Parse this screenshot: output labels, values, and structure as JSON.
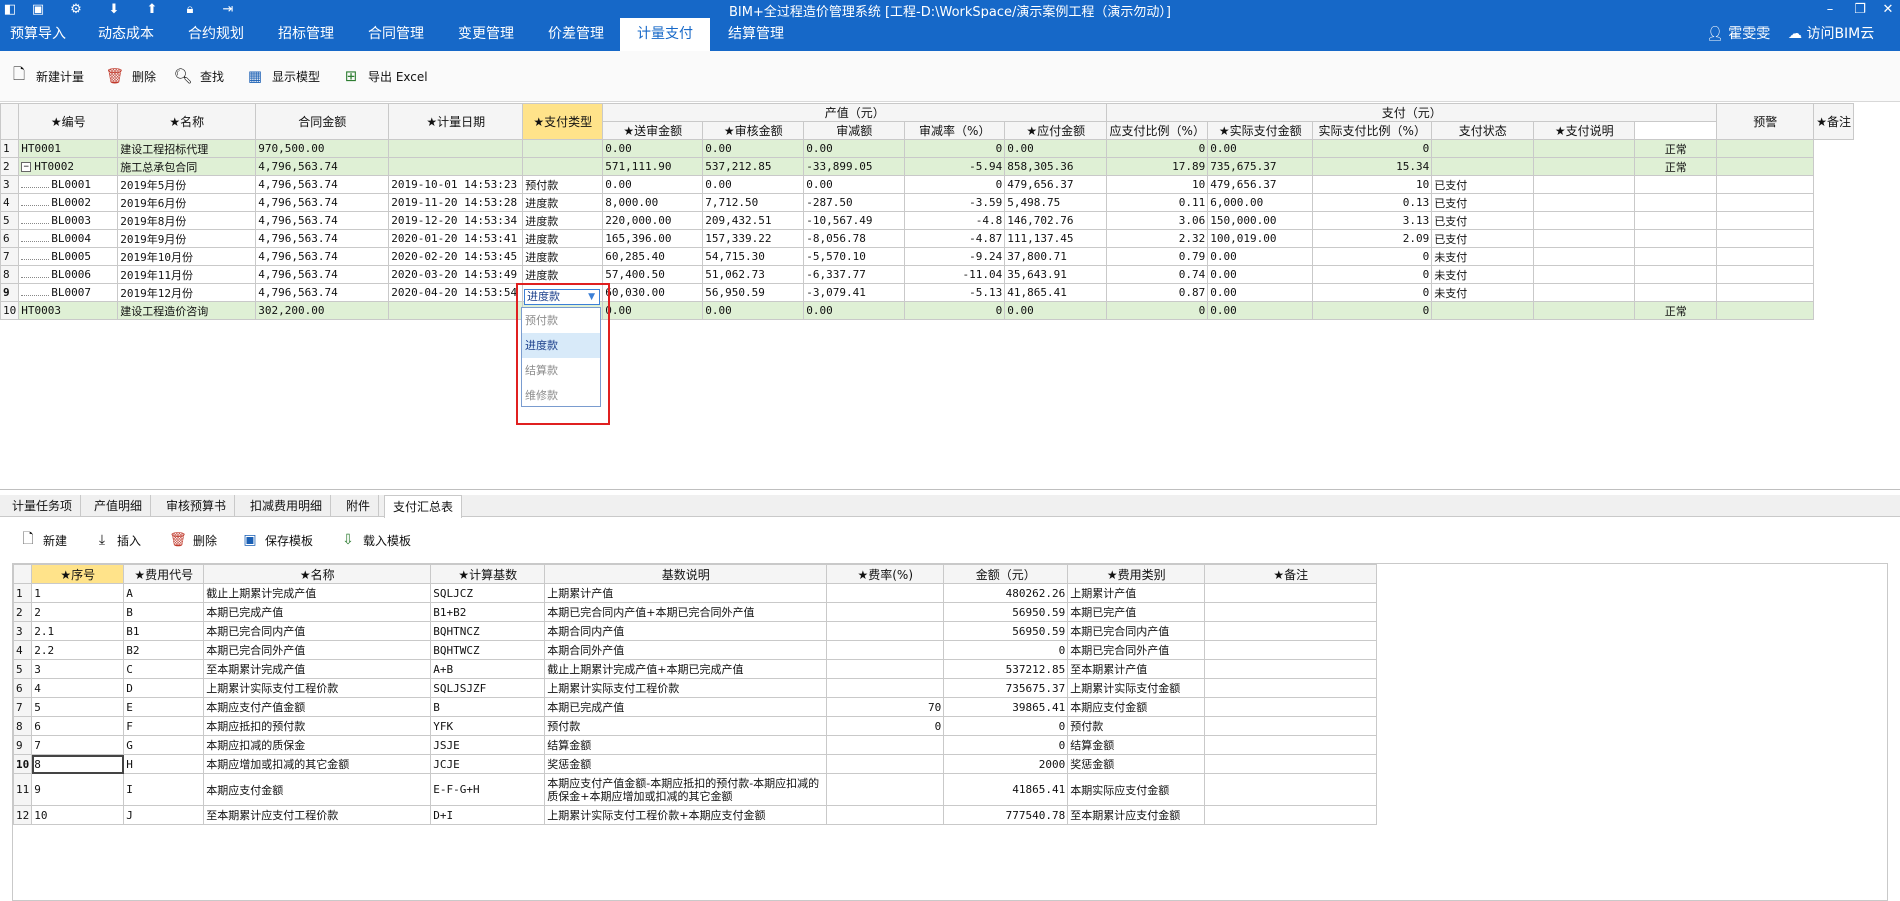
{
  "titlebar": {
    "title": "BIM+全过程造价管理系统 [工程-D:\\WorkSpace/演示案例工程（演示勿动）]"
  },
  "menubar": {
    "items": [
      "预算导入",
      "动态成本",
      "合约规划",
      "招标管理",
      "合同管理",
      "变更管理",
      "价差管理",
      "计量支付",
      "结算管理"
    ],
    "active_index": 7,
    "user_name": "霍雯雯",
    "visit_label": "访问BIM云"
  },
  "toolbar": {
    "new_label": "新建计量",
    "delete_label": "删除",
    "find_label": "查找",
    "show_model_label": "显示模型",
    "export_label": "导出 Excel"
  },
  "main_table": {
    "group_headers": {
      "output": "产值（元）",
      "payment": "支付（元）"
    },
    "headers": [
      "★编号",
      "★名称",
      "合同金额",
      "★计量日期",
      "★支付类型",
      "★送审金额",
      "★审核金额",
      "审减额",
      "审减率（%）",
      "★应付金额",
      "应支付比例（%）",
      "★实际支付金额",
      "实际支付比例（%）",
      "支付状态",
      "★支付说明",
      "预警",
      "★备注"
    ],
    "rows": [
      {
        "n": "1",
        "code": "HT0001",
        "name": "建设工程招标代理",
        "amount": "970,500.00",
        "date": "",
        "type": "",
        "submit": "0.00",
        "audit": "0.00",
        "reduce": "0.00",
        "rate": "0",
        "payable": "0.00",
        "payratio": "0",
        "actual": "0.00",
        "actratio": "0",
        "status": "",
        "note": "",
        "warn": "正常",
        "remark": ""
      },
      {
        "n": "2",
        "code": "HT0002",
        "name": "施工总承包合同",
        "amount": "4,796,563.74",
        "date": "",
        "type": "",
        "submit": "571,111.90",
        "audit": "537,212.85",
        "reduce": "-33,899.05",
        "rate": "-5.94",
        "payable": "858,305.36",
        "payratio": "17.89",
        "actual": "735,675.37",
        "actratio": "15.34",
        "status": "",
        "note": "",
        "warn": "正常",
        "remark": ""
      },
      {
        "n": "3",
        "code": "BL0001",
        "name": "2019年5月份",
        "amount": "4,796,563.74",
        "date": "2019-10-01 14:53:23",
        "type": "预付款",
        "submit": "0.00",
        "audit": "0.00",
        "reduce": "0.00",
        "rate": "0",
        "payable": "479,656.37",
        "payratio": "10",
        "actual": "479,656.37",
        "actratio": "10",
        "status": "已支付",
        "note": "",
        "warn": "",
        "remark": ""
      },
      {
        "n": "4",
        "code": "BL0002",
        "name": "2019年6月份",
        "amount": "4,796,563.74",
        "date": "2019-11-20 14:53:28",
        "type": "进度款",
        "submit": "8,000.00",
        "audit": "7,712.50",
        "reduce": "-287.50",
        "rate": "-3.59",
        "payable": "5,498.75",
        "payratio": "0.11",
        "actual": "6,000.00",
        "actratio": "0.13",
        "status": "已支付",
        "note": "",
        "warn": "",
        "remark": ""
      },
      {
        "n": "5",
        "code": "BL0003",
        "name": "2019年8月份",
        "amount": "4,796,563.74",
        "date": "2019-12-20 14:53:34",
        "type": "进度款",
        "submit": "220,000.00",
        "audit": "209,432.51",
        "reduce": "-10,567.49",
        "rate": "-4.8",
        "payable": "146,702.76",
        "payratio": "3.06",
        "actual": "150,000.00",
        "actratio": "3.13",
        "status": "已支付",
        "note": "",
        "warn": "",
        "remark": ""
      },
      {
        "n": "6",
        "code": "BL0004",
        "name": "2019年9月份",
        "amount": "4,796,563.74",
        "date": "2020-01-20 14:53:41",
        "type": "进度款",
        "submit": "165,396.00",
        "audit": "157,339.22",
        "reduce": "-8,056.78",
        "rate": "-4.87",
        "payable": "111,137.45",
        "payratio": "2.32",
        "actual": "100,019.00",
        "actratio": "2.09",
        "status": "已支付",
        "note": "",
        "warn": "",
        "remark": ""
      },
      {
        "n": "7",
        "code": "BL0005",
        "name": "2019年10月份",
        "amount": "4,796,563.74",
        "date": "2020-02-20 14:53:45",
        "type": "进度款",
        "submit": "60,285.40",
        "audit": "54,715.30",
        "reduce": "-5,570.10",
        "rate": "-9.24",
        "payable": "37,800.71",
        "payratio": "0.79",
        "actual": "0.00",
        "actratio": "0",
        "status": "未支付",
        "note": "",
        "warn": "",
        "remark": ""
      },
      {
        "n": "8",
        "code": "BL0006",
        "name": "2019年11月份",
        "amount": "4,796,563.74",
        "date": "2020-03-20 14:53:49",
        "type": "进度款",
        "submit": "57,400.50",
        "audit": "51,062.73",
        "reduce": "-6,337.77",
        "rate": "-11.04",
        "payable": "35,643.91",
        "payratio": "0.74",
        "actual": "0.00",
        "actratio": "0",
        "status": "未支付",
        "note": "",
        "warn": "",
        "remark": ""
      },
      {
        "n": "9",
        "code": "BL0007",
        "name": "2019年12月份",
        "amount": "4,796,563.74",
        "date": "2020-04-20 14:53:54",
        "type": "",
        "submit": "60,030.00",
        "audit": "56,950.59",
        "reduce": "-3,079.41",
        "rate": "-5.13",
        "payable": "41,865.41",
        "payratio": "0.87",
        "actual": "0.00",
        "actratio": "0",
        "status": "未支付",
        "note": "",
        "warn": "",
        "remark": ""
      },
      {
        "n": "10",
        "code": "HT0003",
        "name": "建设工程造价咨询",
        "amount": "302,200.00",
        "date": "",
        "type": "",
        "submit": "0.00",
        "audit": "0.00",
        "reduce": "0.00",
        "rate": "0",
        "payable": "0.00",
        "payratio": "0",
        "actual": "0.00",
        "actratio": "0",
        "status": "",
        "note": "",
        "warn": "正常",
        "remark": ""
      }
    ]
  },
  "dropdown": {
    "selected": "进度款",
    "options": [
      "预付款",
      "进度款",
      "结算款",
      "维修款"
    ],
    "highlighted_index": 1
  },
  "bottom_tabs": {
    "items": [
      "计量任务项",
      "产值明细",
      "审核预算书",
      "扣减费用明细",
      "附件",
      "支付汇总表"
    ],
    "active_index": 5
  },
  "toolbar2": {
    "new_label": "新建",
    "insert_label": "插入",
    "delete_label": "删除",
    "save_template_label": "保存模板",
    "load_template_label": "载入模板"
  },
  "sub_table": {
    "headers": [
      "★序号",
      "★费用代号",
      "★名称",
      "★计算基数",
      "基数说明",
      "★费率(%)",
      "金额（元）",
      "★费用类别",
      "★备注"
    ],
    "rows": [
      {
        "n": "1",
        "seq": "1",
        "code": "A",
        "name": "截止上期累计完成产值",
        "base": "SQLJCZ",
        "desc": "上期累计产值",
        "rate": "",
        "amount": "480262.26",
        "category": "上期累计产值",
        "remark": ""
      },
      {
        "n": "2",
        "seq": "2",
        "code": "B",
        "name": "本期已完成产值",
        "base": "B1+B2",
        "desc": "本期已完合同内产值+本期已完合同外产值",
        "rate": "",
        "amount": "56950.59",
        "category": "本期已完产值",
        "remark": ""
      },
      {
        "n": "3",
        "seq": "2.1",
        "code": "B1",
        "name": "本期已完合同内产值",
        "base": "BQHTNCZ",
        "desc": "本期合同内产值",
        "rate": "",
        "amount": "56950.59",
        "category": "本期已完合同内产值",
        "remark": ""
      },
      {
        "n": "4",
        "seq": "2.2",
        "code": "B2",
        "name": "本期已完合同外产值",
        "base": "BQHTWCZ",
        "desc": "本期合同外产值",
        "rate": "",
        "amount": "0",
        "category": "本期已完合同外产值",
        "remark": ""
      },
      {
        "n": "5",
        "seq": "3",
        "code": "C",
        "name": "至本期累计完成产值",
        "base": "A+B",
        "desc": "截止上期累计完成产值+本期已完成产值",
        "rate": "",
        "amount": "537212.85",
        "category": "至本期累计产值",
        "remark": ""
      },
      {
        "n": "6",
        "seq": "4",
        "code": "D",
        "name": "上期累计实际支付工程价款",
        "base": "SQLJSJZF",
        "desc": "上期累计实际支付工程价款",
        "rate": "",
        "amount": "735675.37",
        "category": "上期累计实际支付金额",
        "remark": ""
      },
      {
        "n": "7",
        "seq": "5",
        "code": "E",
        "name": "本期应支付产值金额",
        "base": "B",
        "desc": "本期已完成产值",
        "rate": "70",
        "amount": "39865.41",
        "category": "本期应支付金额",
        "remark": ""
      },
      {
        "n": "8",
        "seq": "6",
        "code": "F",
        "name": "本期应抵扣的预付款",
        "base": "YFK",
        "desc": "预付款",
        "rate": "0",
        "amount": "0",
        "category": "预付款",
        "remark": ""
      },
      {
        "n": "9",
        "seq": "7",
        "code": "G",
        "name": "本期应扣减的质保金",
        "base": "JSJE",
        "desc": "结算金额",
        "rate": "",
        "amount": "0",
        "category": "结算金额",
        "remark": ""
      },
      {
        "n": "10",
        "seq": "8",
        "code": "H",
        "name": "本期应增加或扣减的其它金额",
        "base": "JCJE",
        "desc": "奖惩金额",
        "rate": "",
        "amount": "2000",
        "category": "奖惩金额",
        "remark": ""
      },
      {
        "n": "11",
        "seq": "9",
        "code": "I",
        "name": "本期应支付金额",
        "base": "E-F-G+H",
        "desc": "本期应支付产值金额-本期应抵扣的预付款-本期应扣减的质保金+本期应增加或扣减的其它金额",
        "rate": "",
        "amount": "41865.41",
        "category": "本期实际应支付金额",
        "remark": ""
      },
      {
        "n": "12",
        "seq": "10",
        "code": "J",
        "name": "至本期累计应支付工程价款",
        "base": "D+I",
        "desc": "上期累计实际支付工程价款+本期应支付金额",
        "rate": "",
        "amount": "777540.78",
        "category": "至本期累计应支付金额",
        "remark": ""
      }
    ]
  }
}
